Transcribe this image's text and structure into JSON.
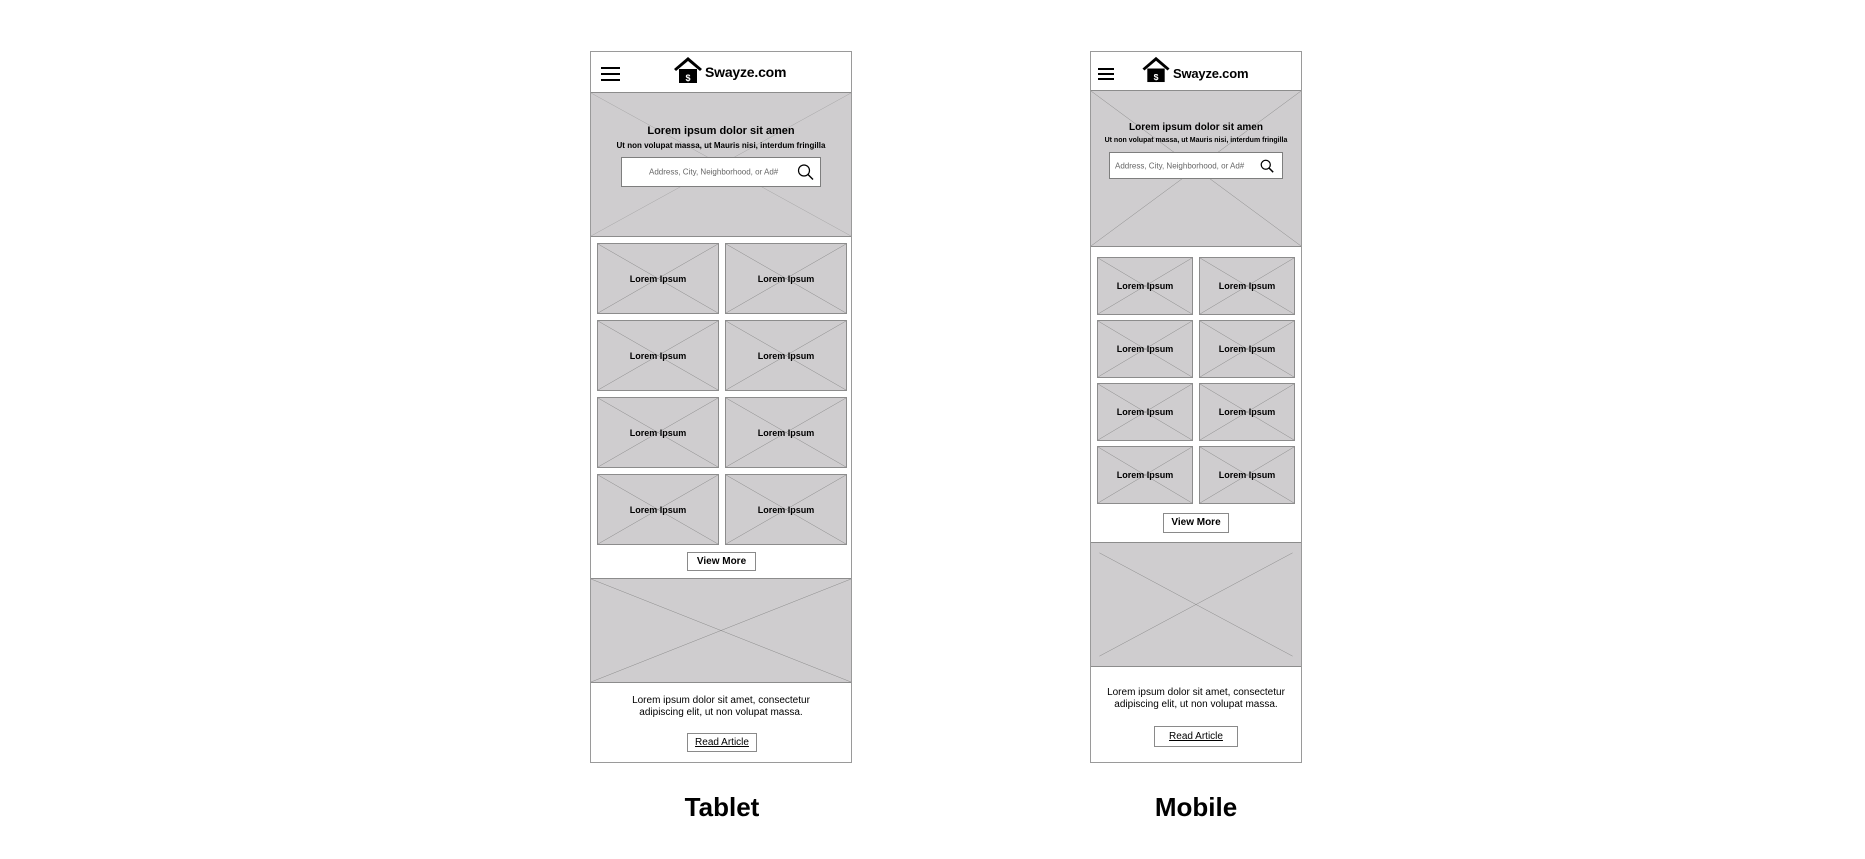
{
  "tablet": {
    "header": {
      "menu_icon": "hamburger-menu-icon",
      "logo_icon": "house-dollar-icon",
      "logo_text": "Swayze.com"
    },
    "hero": {
      "title": "Lorem ipsum dolor sit amen",
      "subtitle": "Ut non volupat massa, ut Mauris nisi, interdum fringilla",
      "search_placeholder": "Address, City, Neighborhood, or Ad#",
      "search_icon": "search-icon"
    },
    "tiles": [
      "Lorem Ipsum",
      "Lorem Ipsum",
      "Lorem Ipsum",
      "Lorem Ipsum",
      "Lorem Ipsum",
      "Lorem Ipsum",
      "Lorem Ipsum",
      "Lorem Ipsum"
    ],
    "view_more": "View More",
    "article": {
      "text": "Lorem ipsum dolor sit amet, consectetur adipiscing elit, ut non volupat massa.",
      "button": "Read Article"
    },
    "caption": "Tablet"
  },
  "mobile": {
    "header": {
      "menu_icon": "hamburger-menu-icon",
      "logo_icon": "house-dollar-icon",
      "logo_text": "Swayze.com"
    },
    "hero": {
      "title": "Lorem ipsum dolor sit amen",
      "subtitle": "Ut non volupat massa, ut Mauris nisi, interdum fringilla",
      "search_placeholder": "Address, City, Neighborhood, or Ad#",
      "search_icon": "search-icon"
    },
    "tiles": [
      "Lorem Ipsum",
      "Lorem Ipsum",
      "Lorem Ipsum",
      "Lorem Ipsum",
      "Lorem Ipsum",
      "Lorem Ipsum",
      "Lorem Ipsum",
      "Lorem Ipsum"
    ],
    "view_more": "View More",
    "article": {
      "text": "Lorem ipsum dolor sit amet, consectetur adipiscing elit, ut non volupat massa.",
      "button": "Read Article"
    },
    "caption": "Mobile"
  }
}
